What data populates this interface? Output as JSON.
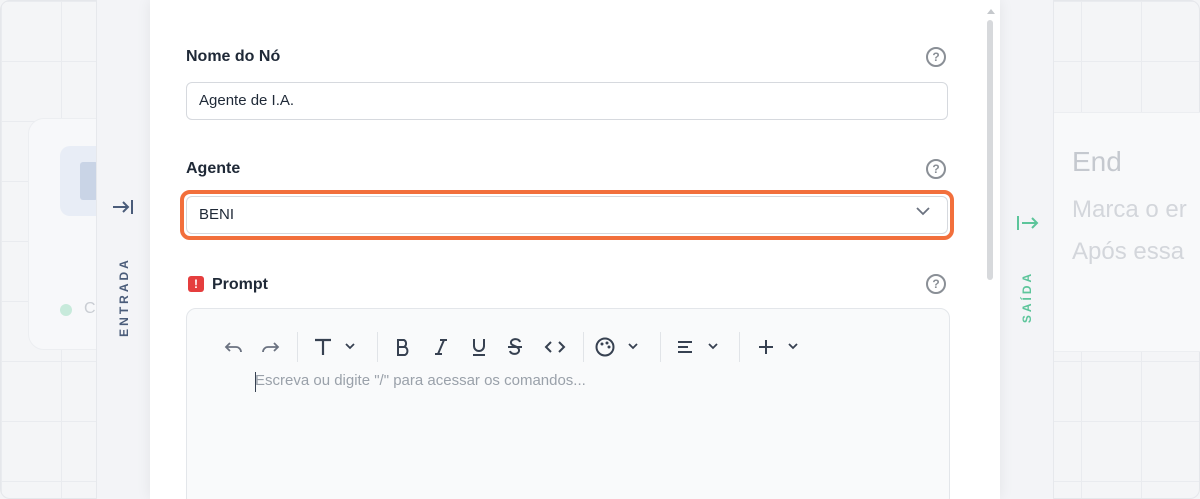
{
  "background": {
    "end_node": {
      "title": "End",
      "line1": "Marca o er",
      "line2": "Após essa"
    },
    "left_node_fragment": "C"
  },
  "rails": {
    "input_label": "ENTRADA",
    "output_label": "SAÍDA"
  },
  "form": {
    "node_name": {
      "label": "Nome do Nó",
      "value": "Agente de I.A.",
      "help": "?"
    },
    "agent": {
      "label": "Agente",
      "selected": "BENI",
      "help": "?"
    },
    "prompt": {
      "required_badge": "!",
      "label": "Prompt",
      "help": "?",
      "placeholder": "Escreva ou digite \"/\" para acessar os comandos..."
    }
  },
  "colors": {
    "highlight": "#f26f3c",
    "required": "#e53e3e",
    "entrada": "#4a5c7a",
    "saida": "#5cc59b"
  },
  "toolbar": [
    "undo-icon",
    "redo-icon",
    "text-type-icon",
    "bold-icon",
    "italic-icon",
    "underline-icon",
    "strikethrough-icon",
    "code-icon",
    "palette-icon",
    "align-icon",
    "plus-icon"
  ]
}
